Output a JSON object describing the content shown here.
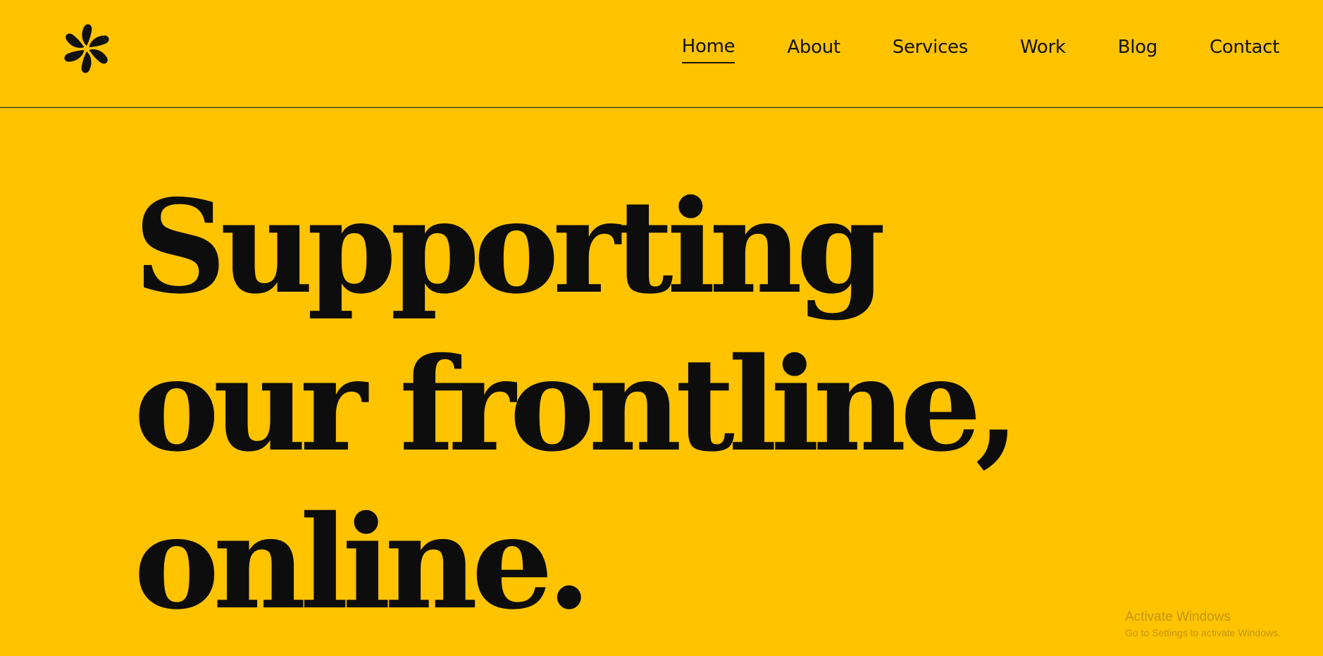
{
  "colors": {
    "background": "#FFC300",
    "text": "#0d0d0d"
  },
  "logo": {
    "icon": "pinwheel-logo-icon"
  },
  "nav": {
    "items": [
      {
        "label": "Home",
        "active": true
      },
      {
        "label": "About",
        "active": false
      },
      {
        "label": "Services",
        "active": false
      },
      {
        "label": "Work",
        "active": false
      },
      {
        "label": "Blog",
        "active": false
      },
      {
        "label": "Contact",
        "active": false
      }
    ]
  },
  "hero": {
    "line1": "Supporting",
    "line2": "our frontline,",
    "line3": "online."
  },
  "watermark": {
    "title": "Activate Windows",
    "subtitle": "Go to Settings to activate Windows."
  }
}
